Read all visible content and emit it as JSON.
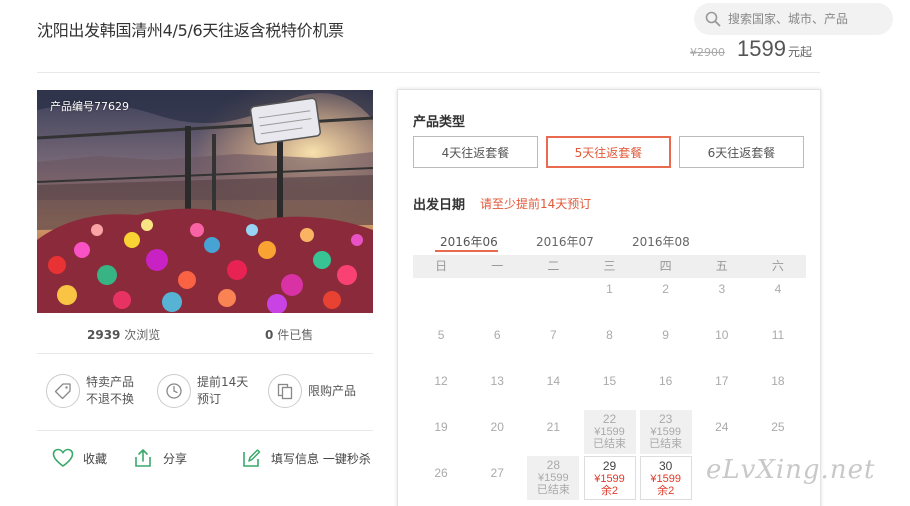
{
  "header": {
    "title": "沈阳出发韩国清州4/5/6天往返含税特价机票",
    "search_placeholder": "搜索国家、城市、产品",
    "old_price": "¥2900",
    "price": "1599",
    "price_unit": "元起"
  },
  "product": {
    "code": "产品编号77629",
    "views_count": "2939",
    "views_label": "次浏览",
    "sold_count": "0",
    "sold_label": "件已售",
    "features": [
      {
        "line1": "特卖产品",
        "line2": "不退不换"
      },
      {
        "line1": "提前14天",
        "line2": "预订"
      },
      {
        "line1": "限购产品",
        "line2": ""
      }
    ],
    "actions": {
      "favorite": "收藏",
      "share": "分享",
      "fill_info": "填写信息 一键秒杀"
    }
  },
  "booking": {
    "type_label": "产品类型",
    "packages": [
      "4天往返套餐",
      "5天往返套餐",
      "6天往返套餐"
    ],
    "selected_package": 1,
    "date_label": "出发日期",
    "date_note": "请至少提前14天预订",
    "months": [
      "2016年06",
      "2016年07",
      "2016年08"
    ],
    "selected_month": 0,
    "weekdays": [
      "日",
      "一",
      "二",
      "三",
      "四",
      "五",
      "六"
    ],
    "days": [
      {
        "d": "1",
        "col": 3,
        "row": 0
      },
      {
        "d": "2",
        "col": 4,
        "row": 0
      },
      {
        "d": "3",
        "col": 5,
        "row": 0
      },
      {
        "d": "4",
        "col": 6,
        "row": 0
      },
      {
        "d": "5",
        "col": 0,
        "row": 1
      },
      {
        "d": "6",
        "col": 1,
        "row": 1
      },
      {
        "d": "7",
        "col": 2,
        "row": 1
      },
      {
        "d": "8",
        "col": 3,
        "row": 1
      },
      {
        "d": "9",
        "col": 4,
        "row": 1
      },
      {
        "d": "10",
        "col": 5,
        "row": 1
      },
      {
        "d": "11",
        "col": 6,
        "row": 1
      },
      {
        "d": "12",
        "col": 0,
        "row": 2
      },
      {
        "d": "13",
        "col": 1,
        "row": 2
      },
      {
        "d": "14",
        "col": 2,
        "row": 2
      },
      {
        "d": "15",
        "col": 3,
        "row": 2
      },
      {
        "d": "16",
        "col": 4,
        "row": 2
      },
      {
        "d": "17",
        "col": 5,
        "row": 2
      },
      {
        "d": "18",
        "col": 6,
        "row": 2
      },
      {
        "d": "19",
        "col": 0,
        "row": 3
      },
      {
        "d": "20",
        "col": 1,
        "row": 3
      },
      {
        "d": "21",
        "col": 2,
        "row": 3
      },
      {
        "d": "22",
        "col": 3,
        "row": 3,
        "state": "ended",
        "price": "¥1599",
        "status": "已结束"
      },
      {
        "d": "23",
        "col": 4,
        "row": 3,
        "state": "ended",
        "price": "¥1599",
        "status": "已结束"
      },
      {
        "d": "24",
        "col": 5,
        "row": 3
      },
      {
        "d": "25",
        "col": 6,
        "row": 3
      },
      {
        "d": "26",
        "col": 0,
        "row": 4
      },
      {
        "d": "27",
        "col": 1,
        "row": 4
      },
      {
        "d": "28",
        "col": 2,
        "row": 4,
        "state": "ended",
        "price": "¥1599",
        "status": "已结束"
      },
      {
        "d": "29",
        "col": 3,
        "row": 4,
        "state": "sale",
        "price": "¥1599",
        "status": "余2"
      },
      {
        "d": "30",
        "col": 4,
        "row": 4,
        "state": "sale",
        "price": "¥1599",
        "status": "余2"
      }
    ]
  },
  "watermark": "eLvXing.net",
  "colors": {
    "accent": "#e05a3a",
    "sale_price": "#e03a2a",
    "border": "#e3e3e3"
  }
}
